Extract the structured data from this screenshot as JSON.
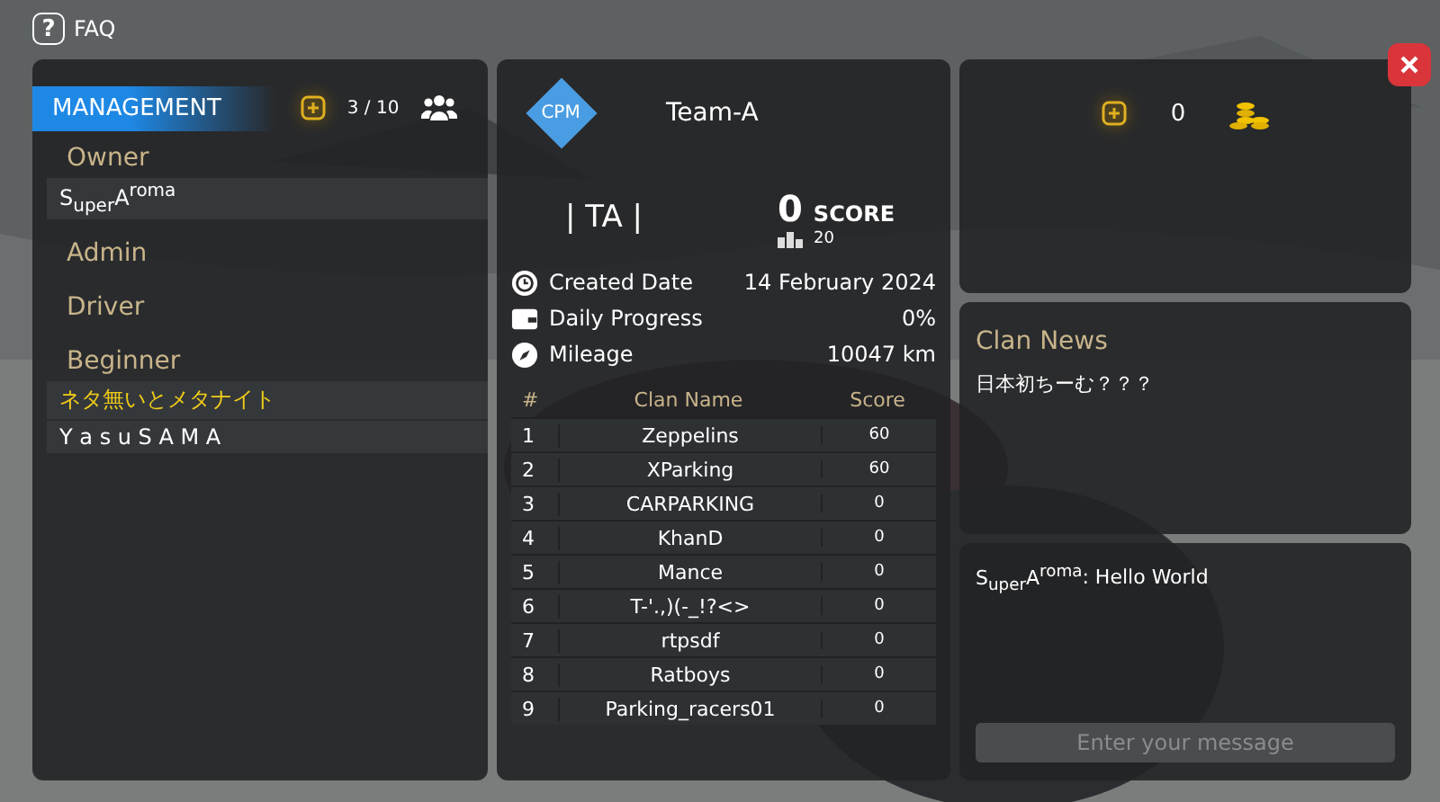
{
  "faq": {
    "icon": "?",
    "label": "FAQ"
  },
  "management": {
    "title": "MANAGEMENT",
    "count": "3 / 10",
    "roles": [
      {
        "name": "Owner",
        "members": [
          {
            "name": "S$_{uper}$A$^{roma}$",
            "highlight": false
          }
        ]
      },
      {
        "name": "Admin"
      },
      {
        "name": "Driver"
      },
      {
        "name": "Beginner",
        "members": [
          {
            "name": "ネタ無いとメタナイト",
            "highlight": true
          },
          {
            "name": "Y a s u S A M A",
            "highlight": false
          }
        ]
      }
    ]
  },
  "clan": {
    "logo": "CPM",
    "name": "Team-A",
    "tag": "| TA |",
    "score": "0",
    "score_label": "SCORE",
    "rank": "20",
    "stats": [
      {
        "kind": "clock",
        "label": "Created Date",
        "value": "14 February 2024"
      },
      {
        "kind": "wallet",
        "label": "Daily Progress",
        "value": "0%"
      },
      {
        "kind": "compass",
        "label": "Mileage",
        "value": "10047 km"
      }
    ]
  },
  "leaderboard": {
    "columns": [
      "#",
      "Clan Name",
      "Score"
    ],
    "rows": [
      [
        "1",
        "Zeppelins",
        "60"
      ],
      [
        "2",
        "XParking",
        "60"
      ],
      [
        "3",
        "CARPARKING",
        "0"
      ],
      [
        "4",
        "KhanD",
        "0"
      ],
      [
        "5",
        "Mance",
        "0"
      ],
      [
        "6",
        "T-'.,)(-_!?<>",
        "0"
      ],
      [
        "7",
        "rtpsdf",
        "0"
      ],
      [
        "8",
        "Ratboys",
        "0"
      ],
      [
        "9",
        "Parking_racers01",
        "0"
      ]
    ]
  },
  "coins": {
    "amount": "0"
  },
  "news": {
    "title": "Clan News",
    "text": "日本初ちーむ？？？"
  },
  "chat": {
    "messages": [
      {
        "author": "S$_{uper}$A$^{roma}$",
        "text": ": Hello World"
      }
    ],
    "placeholder": "Enter your message"
  }
}
